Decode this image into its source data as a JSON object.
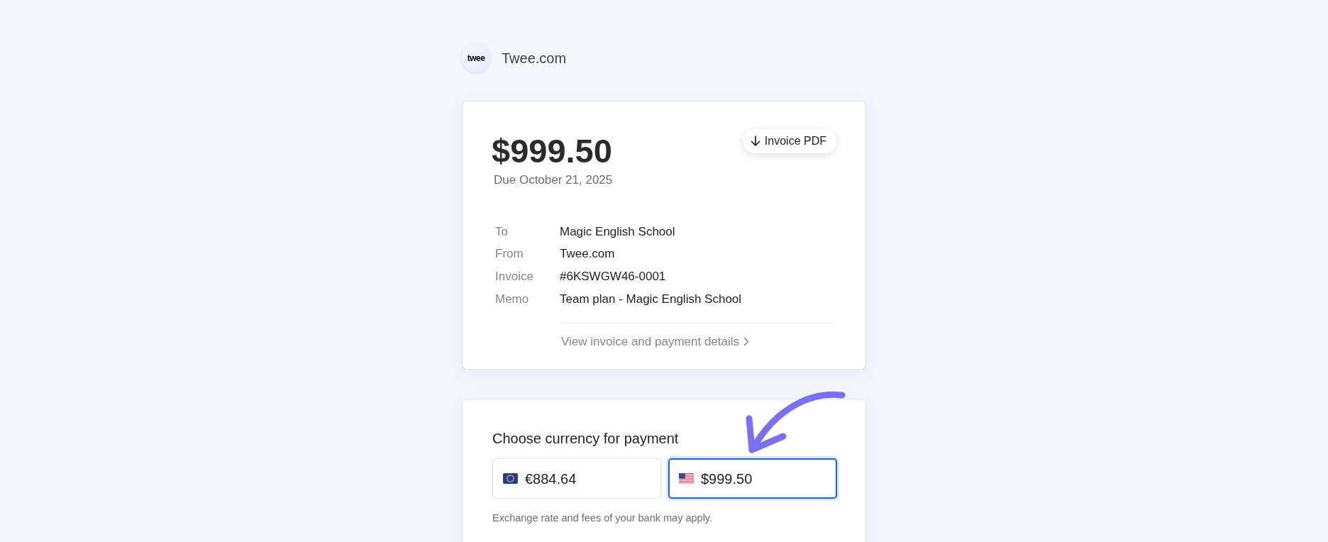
{
  "brand": {
    "logo_text": "twee",
    "name": "Twee.com"
  },
  "invoice": {
    "amount": "$999.50",
    "due": "Due October 21, 2025",
    "pdf_button": "Invoice PDF",
    "rows": [
      {
        "label": "To",
        "value": "Magic English School"
      },
      {
        "label": "From",
        "value": "Twee.com"
      },
      {
        "label": "Invoice",
        "value": "#6KSWGW46-0001"
      },
      {
        "label": "Memo",
        "value": "Team plan - Magic English School"
      }
    ],
    "details_link": "View invoice and payment details"
  },
  "payment": {
    "title": "Choose currency for payment",
    "options": [
      {
        "kind": "eur",
        "amount": "€884.64",
        "selected": false
      },
      {
        "kind": "usd",
        "amount": "$999.50",
        "selected": true
      }
    ],
    "note": "Exchange rate and fees of your bank may apply."
  }
}
